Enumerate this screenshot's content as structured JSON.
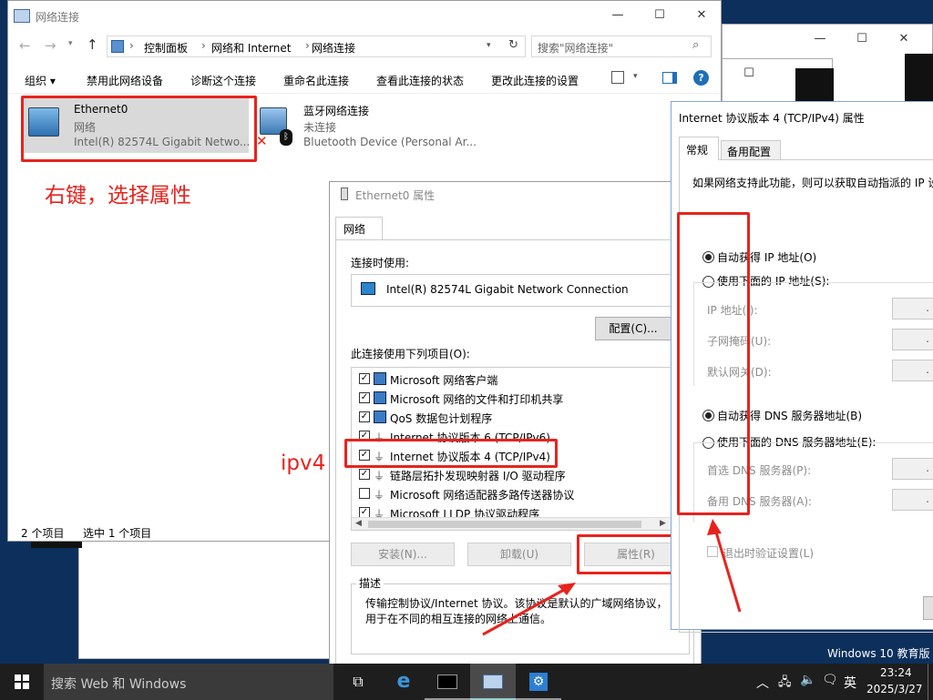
{
  "background_windows": {
    "win1_controls": [
      "—",
      "☐",
      "✕"
    ],
    "win2_controls": [
      "☐"
    ]
  },
  "explorer": {
    "title": "网络连接",
    "controls": [
      "—",
      "☐",
      "✕"
    ],
    "breadcrumb": [
      "控制面板",
      "网络和 Internet",
      "网络连接"
    ],
    "search_placeholder": "搜索\"网络连接\"",
    "toolbar": [
      "组织 ▾",
      "禁用此网络设备",
      "诊断这个连接",
      "重命名此连接",
      "查看此连接的状态",
      "更改此连接的设置"
    ],
    "items": [
      {
        "name": "Ethernet0",
        "status": "网络",
        "device": "Intel(R) 82574L Gigabit Netwo..."
      },
      {
        "name": "蓝牙网络连接",
        "status": "未连接",
        "device": "Bluetooth Device (Personal Ar..."
      }
    ],
    "status_count": "2 个项目",
    "status_selected": "选中 1 个项目"
  },
  "annotations": {
    "right_click": "右键，选择属性",
    "ipv4": "ipv4"
  },
  "props": {
    "title": "Ethernet0 属性",
    "tab": "网络",
    "connect_using_label": "连接时使用:",
    "adapter": "Intel(R) 82574L Gigabit Network Connection",
    "configure_button": "配置(C)...",
    "items_label": "此连接使用下列项目(O):",
    "items": [
      {
        "label": "Microsoft 网络客户端",
        "checked": true
      },
      {
        "label": "Microsoft 网络的文件和打印机共享",
        "checked": true
      },
      {
        "label": "QoS 数据包计划程序",
        "checked": true
      },
      {
        "label": "Internet 协议版本 6 (TCP/IPv6)",
        "checked": true
      },
      {
        "label": "Internet 协议版本 4 (TCP/IPv4)",
        "checked": true
      },
      {
        "label": "链路层拓扑发现映射器 I/O 驱动程序",
        "checked": true
      },
      {
        "label": "Microsoft 网络适配器多路传送器协议",
        "checked": false
      },
      {
        "label": "Microsoft LLDP 协议驱动程序",
        "checked": true
      }
    ],
    "install_button": "安装(N)...",
    "uninstall_button": "卸载(U)",
    "properties_button": "属性(R)",
    "description_label": "描述",
    "description": "传输控制协议/Internet 协议。该协议是默认的广域网络协议，用于在不同的相互连接的网络上通信。"
  },
  "ipv4": {
    "title": "Internet 协议版本 4 (TCP/IPv4) 属性",
    "tabs": [
      "常规",
      "备用配置"
    ],
    "intro": "如果网络支持此功能，则可以获取自动指派的 IP 设置。否则，你需要从网络系统管理员处获得适当的 IP 设置。",
    "auto_ip": "自动获得 IP 地址(O)",
    "manual_ip": "使用下面的 IP 地址(S):",
    "ip_label": "IP 地址(I):",
    "mask_label": "子网掩码(U):",
    "gateway_label": "默认网关(D):",
    "auto_dns": "自动获得 DNS 服务器地址(B)",
    "manual_dns": "使用下面的 DNS 服务器地址(E):",
    "dns1_label": "首选 DNS 服务器(P):",
    "dns2_label": "备用 DNS 服务器(A):",
    "validate": "退出时验证设置(L)",
    "field_dot": "."
  },
  "watermark": "Windows 10 教育版",
  "taskbar": {
    "search_placeholder": "搜索 Web 和 Windows",
    "lang": "英",
    "time": "23:24",
    "date": "2025/3/27"
  },
  "colors": {
    "accent": "#0078d7",
    "annotation": "#e8231d",
    "taskbar": "#1e1e1e"
  }
}
